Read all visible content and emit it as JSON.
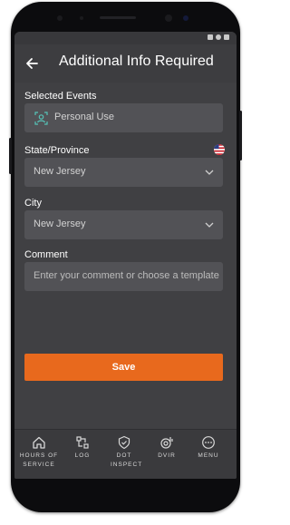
{
  "header": {
    "title": "Additional Info Required"
  },
  "form": {
    "selected_events_label": "Selected Events",
    "selected_event_value": "Personal Use",
    "state_label": "State/Province",
    "state_value": "New Jersey",
    "city_label": "City",
    "city_value": "New Jersey",
    "comment_label": "Comment",
    "comment_placeholder": "Enter your comment or choose a template",
    "save_label": "Save"
  },
  "bottom_nav": {
    "hours_of_service": "HOURS OF SERVICE",
    "log": "LOG",
    "dot_inspect": "DOT INSPECT",
    "dvir": "DVIR",
    "menu": "MENU"
  },
  "colors": {
    "accent": "#e8691d",
    "background": "#404043",
    "field": "#525256",
    "icon_teal": "#56c4b8"
  }
}
